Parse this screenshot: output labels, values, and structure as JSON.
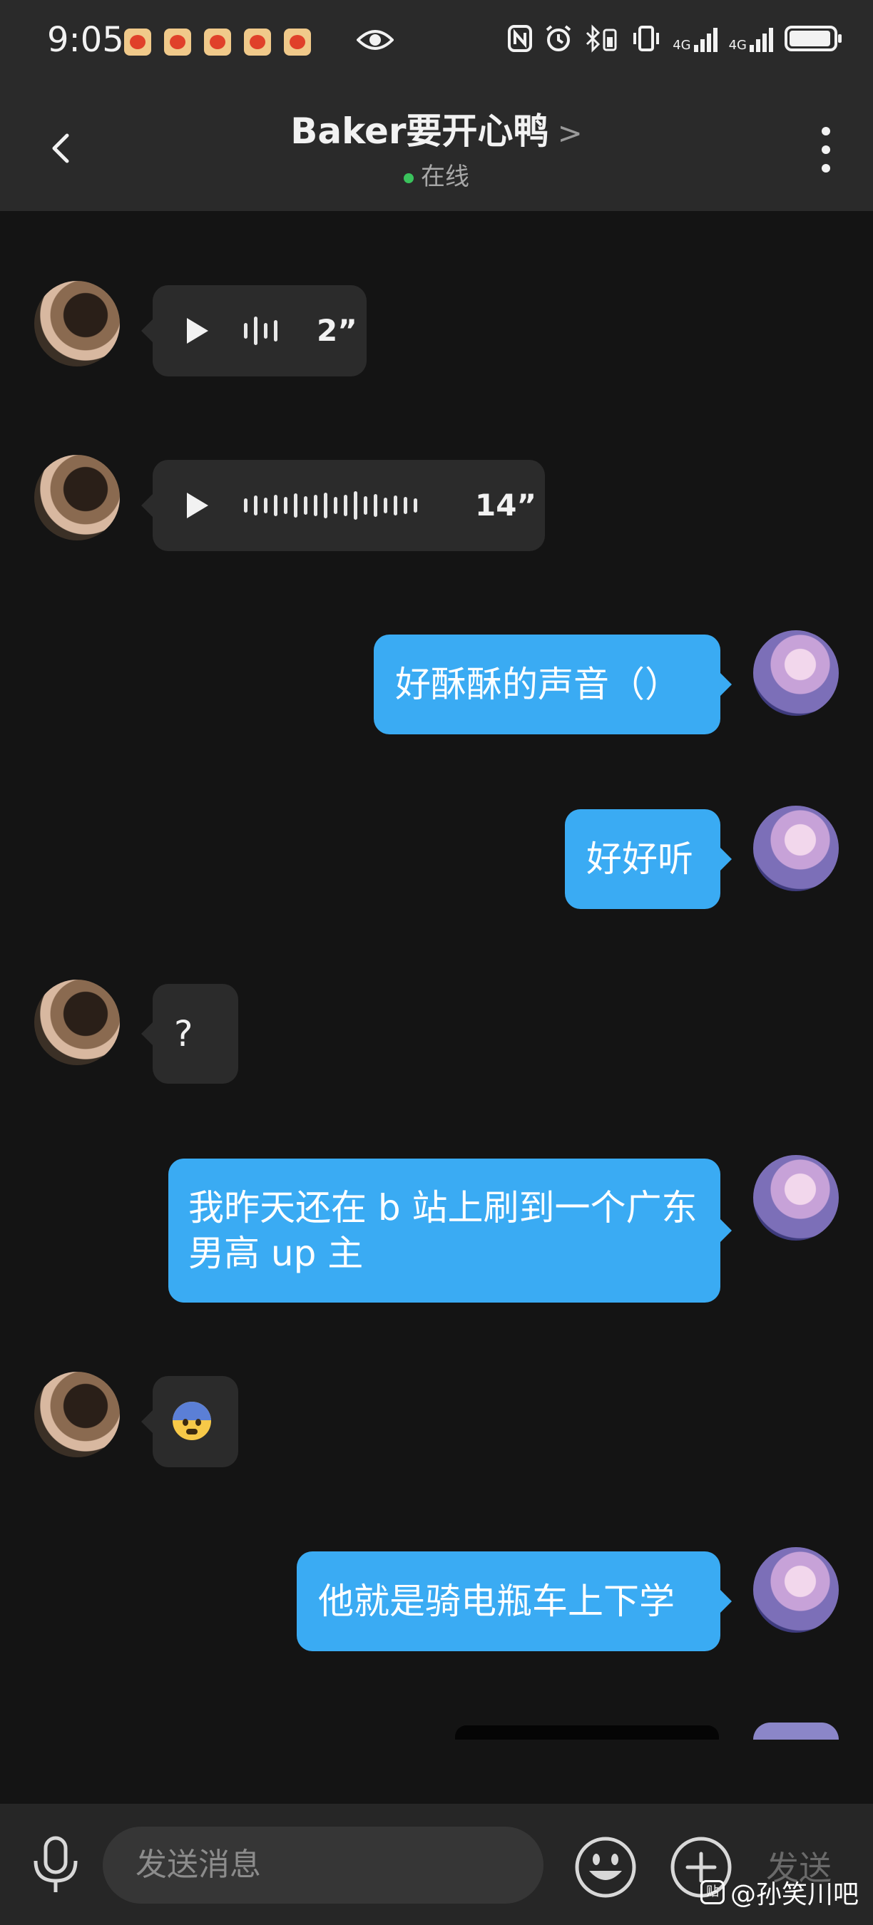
{
  "status_bar": {
    "time": "9:05",
    "tomato_count": 5,
    "network_1": "4G",
    "network_2": "4G"
  },
  "header": {
    "title": "Baker要开心鸭",
    "title_chevron": ">",
    "online_status": "在线"
  },
  "messages": [
    {
      "side": "left",
      "type": "voice",
      "duration": "2”"
    },
    {
      "side": "left",
      "type": "voice",
      "duration": "14”"
    },
    {
      "side": "right",
      "type": "text",
      "text": "好酥酥的声音（）"
    },
    {
      "side": "right",
      "type": "text",
      "text": "好好听"
    },
    {
      "side": "left",
      "type": "text",
      "text": "?"
    },
    {
      "side": "right",
      "type": "text",
      "text": "我昨天还在 b 站上刷到一个广东男高 up 主"
    },
    {
      "side": "left",
      "type": "emoji",
      "emoji": "anxious-face-with-sweat-emoji"
    },
    {
      "side": "right",
      "type": "text",
      "text": "他就是骑电瓶车上下学"
    },
    {
      "side": "right",
      "type": "image",
      "partial": true
    }
  ],
  "input_bar": {
    "placeholder": "发送消息",
    "send_label": "发送"
  },
  "watermark": {
    "logo_text": "贴",
    "text": "@孙笑川吧"
  },
  "colors": {
    "background": "#141414",
    "bar": "#2a2a2a",
    "bubble_incoming": "#2b2b2b",
    "bubble_outgoing": "#3aabf3",
    "online_dot": "#3ac25c"
  }
}
